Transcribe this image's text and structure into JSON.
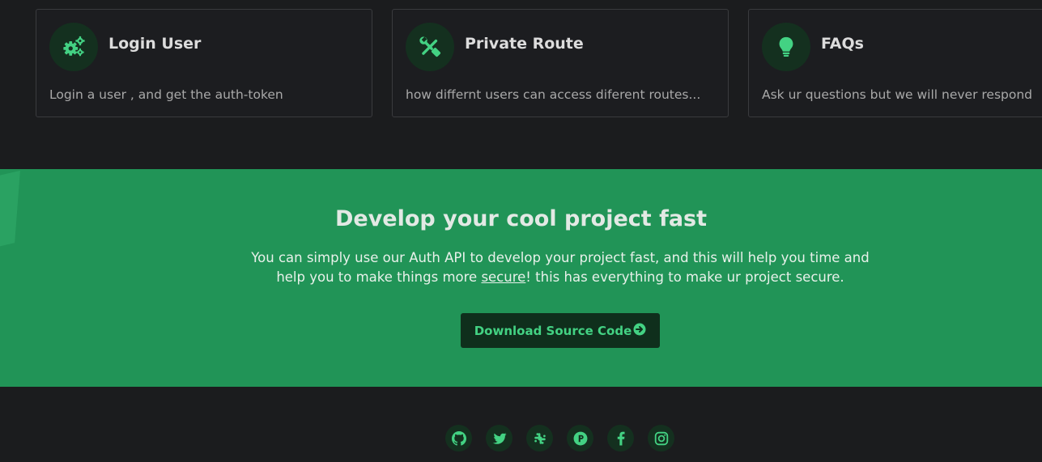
{
  "colors": {
    "background": "#1b1c1e",
    "accent": "#43d283",
    "cta_band": "#219457",
    "icon_circle": "#14301f",
    "button_bg": "#0f2f1c"
  },
  "cards": [
    {
      "icon": "gears-icon",
      "title": "Login User",
      "description": "Login a user , and get the auth-token"
    },
    {
      "icon": "tools-icon",
      "title": "Private Route",
      "description": "how differnt users can access diferent routes..."
    },
    {
      "icon": "lightbulb-icon",
      "title": "FAQs",
      "description": "Ask ur questions but we will never respond"
    }
  ],
  "cta": {
    "title": "Develop your cool project fast",
    "text_before": "You can simply use our Auth API to develop your project fast, and this will help you time and help you to make things more ",
    "link": "secure",
    "text_after": "! this has everything to make ur project secure.",
    "button_label": "Download Source Code",
    "button_icon": "arrow-circle-right-icon"
  },
  "socials": [
    {
      "icon": "github-icon"
    },
    {
      "icon": "twitter-icon"
    },
    {
      "icon": "slack-icon"
    },
    {
      "icon": "producthunt-icon"
    },
    {
      "icon": "facebook-icon"
    },
    {
      "icon": "instagram-icon"
    }
  ]
}
